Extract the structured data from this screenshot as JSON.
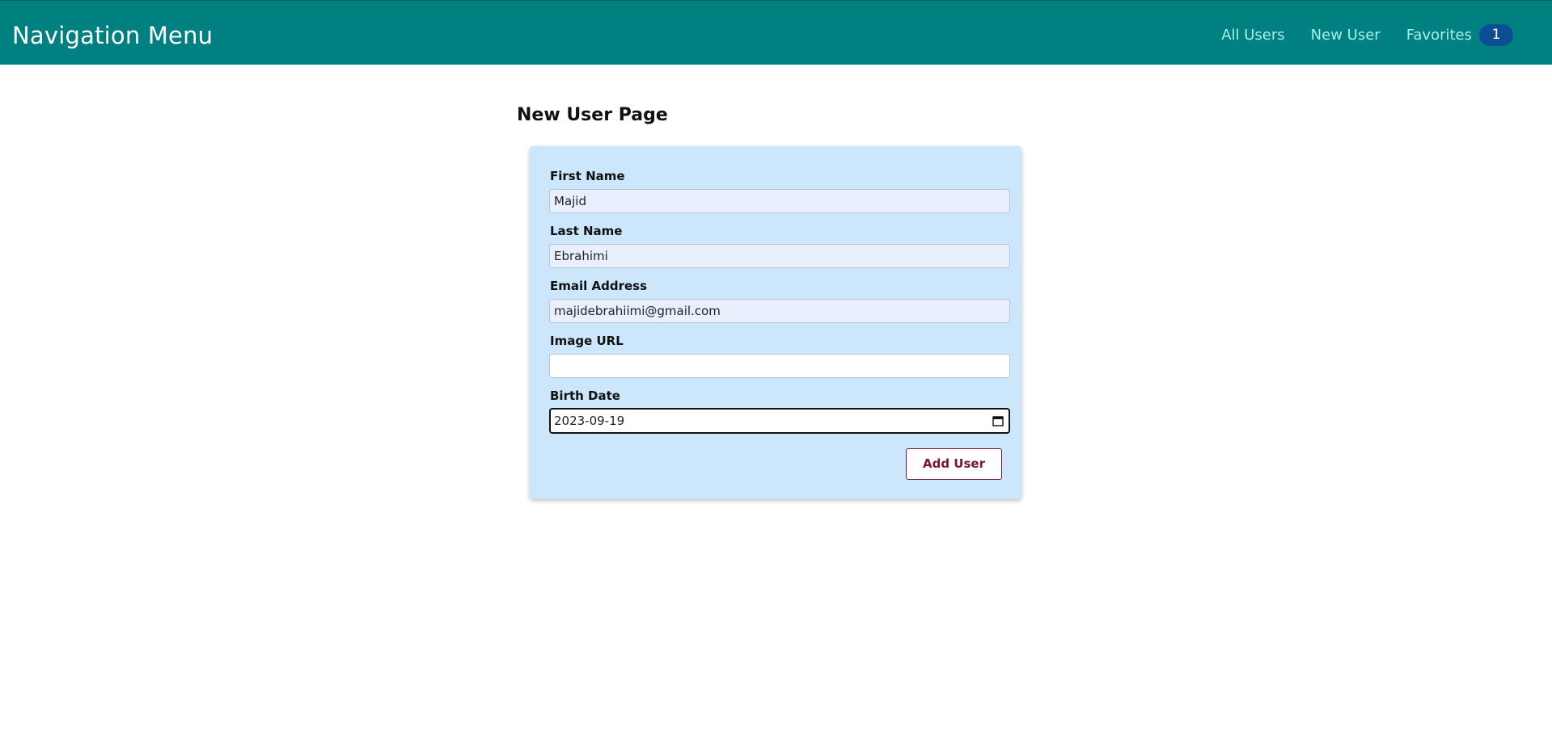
{
  "header": {
    "brand": "Navigation Menu",
    "links": [
      {
        "label": "All Users"
      },
      {
        "label": "New User"
      },
      {
        "label": "Favorites",
        "badge": "1"
      }
    ],
    "background_color": "#008080",
    "badge_color": "#0c4e94"
  },
  "page": {
    "title": "New User Page"
  },
  "form": {
    "first_name": {
      "label": "First Name",
      "value": "Majid"
    },
    "last_name": {
      "label": "Last Name",
      "value": "Ebrahimi"
    },
    "email": {
      "label": "Email Address",
      "value": "majidebrahiimi@gmail.com"
    },
    "image_url": {
      "label": "Image URL",
      "value": ""
    },
    "birth_date": {
      "label": "Birth Date",
      "value": "2023-09-19",
      "icon": "calendar-icon"
    },
    "submit_label": "Add User",
    "card_color": "#cce6fb",
    "submit_color": "#7a1438"
  }
}
